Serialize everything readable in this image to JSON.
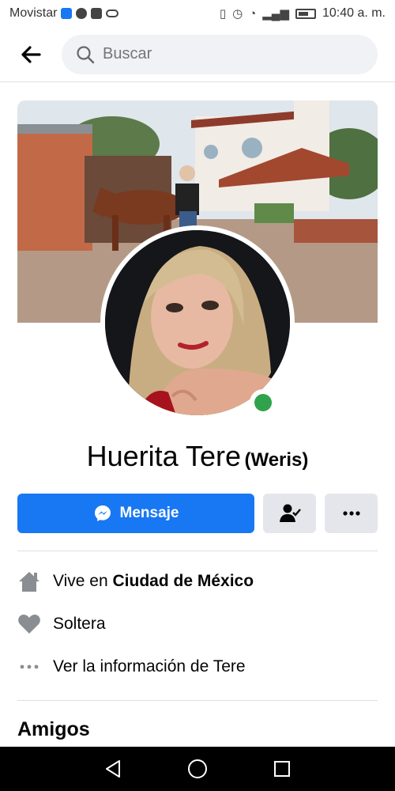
{
  "status_bar": {
    "carrier": "Movistar",
    "time": "10:40 a. m."
  },
  "search": {
    "placeholder": "Buscar"
  },
  "profile": {
    "name": "Huerita Tere",
    "alternate_name": "(Weris)"
  },
  "actions": {
    "message_label": "Mensaje"
  },
  "info": {
    "lives_prefix": "Vive en ",
    "city": "Ciudad de México",
    "relationship": "Soltera",
    "see_info": "Ver la información de Tere"
  },
  "friends": {
    "heading": "Amigos"
  },
  "colors": {
    "accent": "#1877f2",
    "online": "#31a24c",
    "button_gray": "#e4e6eb"
  },
  "icons": [
    "back-arrow-icon",
    "search-icon",
    "messenger-icon",
    "friend-check-icon",
    "more-icon",
    "home-icon",
    "heart-icon",
    "dots-icon",
    "nav-back-icon",
    "nav-home-icon",
    "nav-recents-icon"
  ]
}
